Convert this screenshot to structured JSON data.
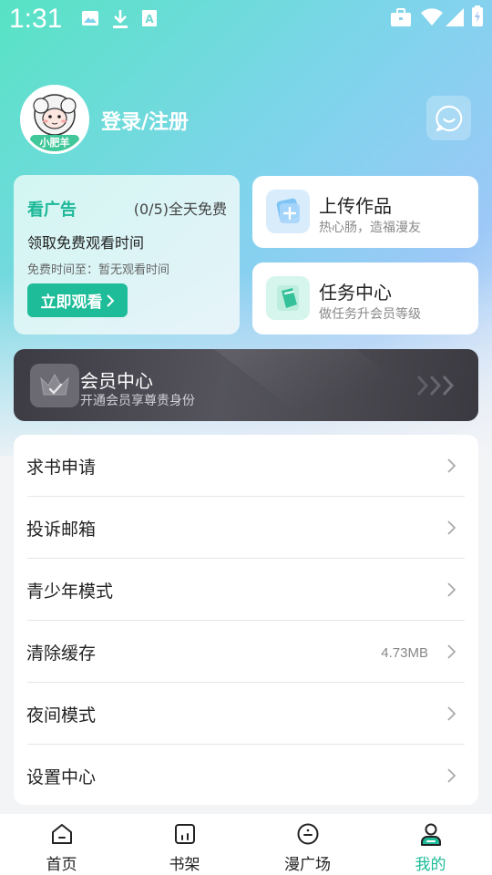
{
  "status_bar": {
    "time": "1:31",
    "icons": [
      "image-icon",
      "download-icon",
      "translate-icon",
      "briefcase-icon",
      "wifi-icon",
      "signal-icon",
      "battery-icon"
    ]
  },
  "header": {
    "avatar_text": "小肥羊",
    "login_label": "登录/注册",
    "message_icon": "chat-bubble-icon"
  },
  "ad_card": {
    "title": "看广告",
    "count": "(0/5)全天免费",
    "description": "领取免费观看时间",
    "free_time": "免费时间至：暂无观看时间",
    "button_label": "立即观看"
  },
  "upload_card": {
    "title": "上传作品",
    "subtitle": "热心肠，造福漫友"
  },
  "task_card": {
    "title": "任务中心",
    "subtitle": "做任务升会员等级"
  },
  "vip": {
    "title": "会员中心",
    "subtitle": "开通会员享尊贵身份"
  },
  "menu": {
    "items": [
      {
        "label": "求书申请",
        "value": ""
      },
      {
        "label": "投诉邮箱",
        "value": ""
      },
      {
        "label": "青少年模式",
        "value": ""
      },
      {
        "label": "清除缓存",
        "value": "4.73MB"
      },
      {
        "label": "夜间模式",
        "value": ""
      },
      {
        "label": "设置中心",
        "value": ""
      }
    ]
  },
  "tabbar": {
    "tabs": [
      {
        "label": "首页",
        "icon": "home-icon"
      },
      {
        "label": "书架",
        "icon": "bookshelf-icon"
      },
      {
        "label": "漫广场",
        "icon": "plaza-icon"
      },
      {
        "label": "我的",
        "icon": "profile-icon"
      }
    ],
    "active_color": "#1ebc99"
  }
}
